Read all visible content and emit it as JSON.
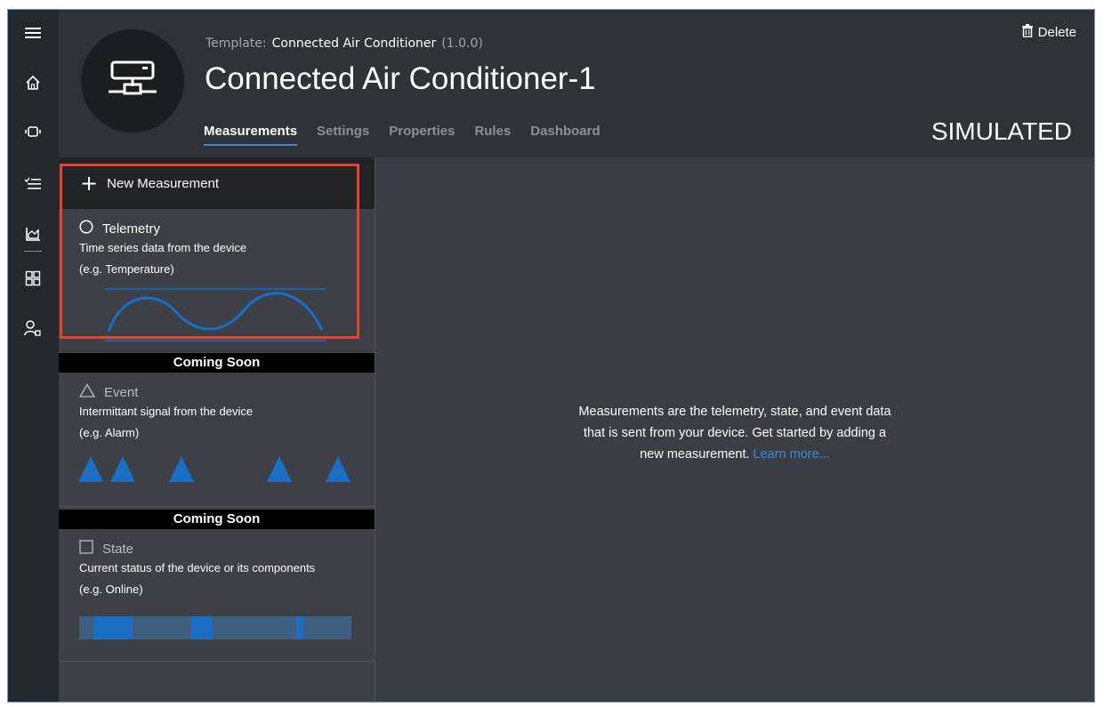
{
  "header": {
    "template_label": "Template:",
    "template_name": "Connected Air Conditioner",
    "template_version": "(1.0.0)",
    "title": "Connected Air Conditioner-1",
    "status": "SIMULATED",
    "delete_label": "Delete"
  },
  "tabs": [
    {
      "label": "Measurements",
      "active": true
    },
    {
      "label": "Settings",
      "active": false
    },
    {
      "label": "Properties",
      "active": false
    },
    {
      "label": "Rules",
      "active": false
    },
    {
      "label": "Dashboard",
      "active": false
    }
  ],
  "rail": {
    "icons": [
      "menu-icon",
      "home-icon",
      "devices-icon",
      "tasks-icon",
      "analytics-icon",
      "dashboard-grid-icon",
      "admin-icon"
    ]
  },
  "panel": {
    "new_label": "New Measurement",
    "telemetry": {
      "title": "Telemetry",
      "desc": "Time series data from the device",
      "example": "(e.g. Temperature)"
    },
    "event": {
      "badge": "Coming Soon",
      "title": "Event",
      "desc": "Intermittant signal from the device",
      "example": "(e.g. Alarm)"
    },
    "state": {
      "badge": "Coming Soon",
      "title": "State",
      "desc": "Current status of the device or its components",
      "example": "(e.g. Online)"
    }
  },
  "content": {
    "line1": "Measurements are the telemetry, state, and event data",
    "line2": "that is sent from your device. Get started by adding a",
    "line3": "new measurement.",
    "link": "Learn more..."
  },
  "colors": {
    "accent": "#3b8ad8",
    "highlight": "#e8412c",
    "chart_blue": "#1a6fc4"
  }
}
